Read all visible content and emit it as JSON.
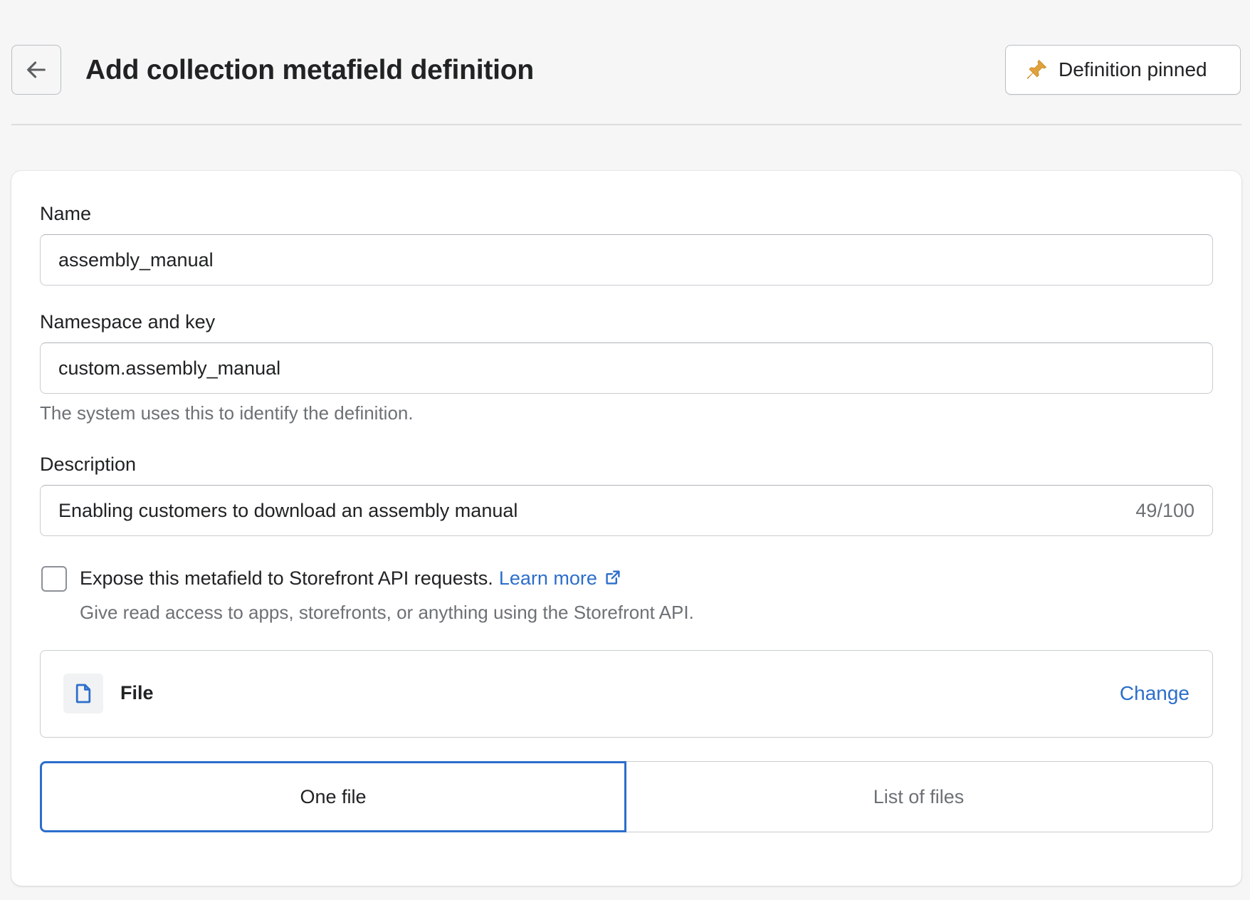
{
  "header": {
    "title": "Add collection metafield definition",
    "pin_label": "Definition pinned",
    "pin_icon_color": "#e1a13c"
  },
  "form": {
    "name": {
      "label": "Name",
      "value": "assembly_manual"
    },
    "namespace": {
      "label": "Namespace and key",
      "value": "custom.assembly_manual",
      "help": "The system uses this to identify the definition."
    },
    "description": {
      "label": "Description",
      "value": "Enabling customers to download an assembly manual",
      "counter": "49/100"
    },
    "storefront": {
      "checked": false,
      "label": "Expose this metafield to Storefront API requests.",
      "link": "Learn more",
      "help": "Give read access to apps, storefronts, or anything using the Storefront API."
    },
    "type": {
      "name": "File",
      "change_label": "Change",
      "icon": "file-icon"
    },
    "cardinality": {
      "options": [
        "One file",
        "List of files"
      ],
      "selected": "One file"
    }
  },
  "colors": {
    "link": "#2c6ecb",
    "text": "#202223",
    "subdued": "#6d7175",
    "background": "#f6f6f6"
  }
}
